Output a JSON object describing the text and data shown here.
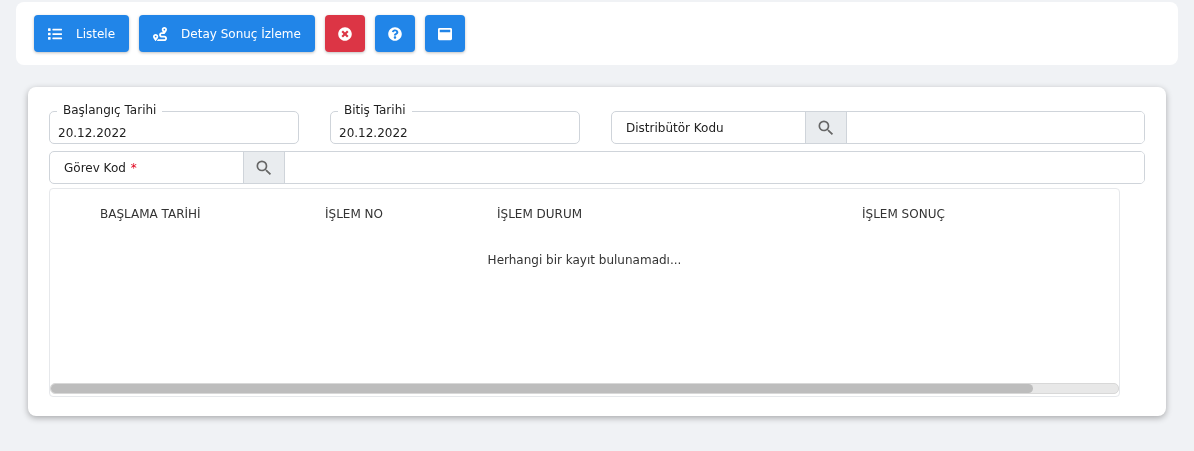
{
  "toolbar": [
    {
      "kind": "primary",
      "label": "Listele"
    },
    {
      "kind": "primary",
      "label": "Detay Sonuç İzleme"
    },
    {
      "kind": "danger"
    },
    {
      "kind": "primary"
    },
    {
      "kind": "primary"
    }
  ],
  "date_fields": [
    {
      "label": "Başlangıç Tarihi",
      "value": "20.12.2022"
    },
    {
      "label": "Bitiş Tarihi",
      "value": "20.12.2022"
    }
  ],
  "lookup_fields": [
    {
      "label": "Distribütör Kodu"
    },
    {
      "label": "Görev Kod",
      "required_mark": "*"
    }
  ],
  "table": {
    "columns": [
      "BAŞLAMA TARİHİ",
      "İŞLEM NO",
      "İŞLEM DURUM",
      "İŞLEM SONUÇ"
    ],
    "empty_message": "Herhangi bir kayıt bulunamadı..."
  }
}
